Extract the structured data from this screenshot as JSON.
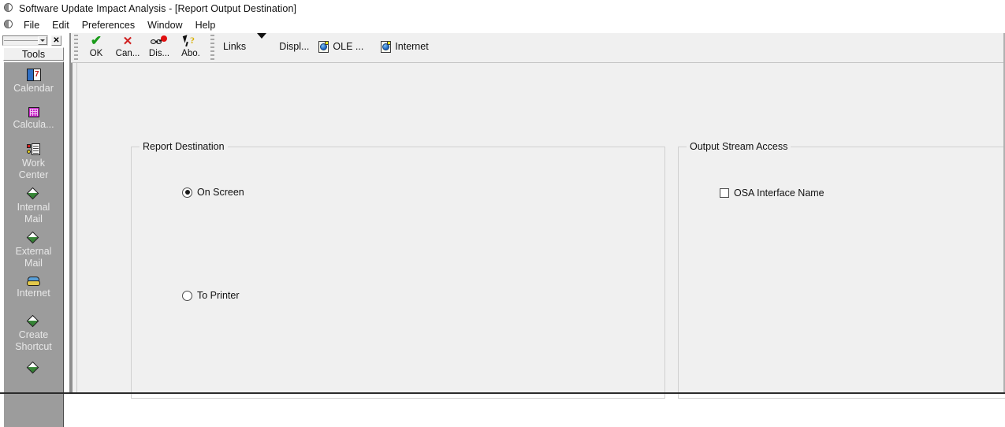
{
  "window": {
    "title": "Software Update Impact Analysis - [Report Output Destination]",
    "icon": "window-circle-icon"
  },
  "menubar": {
    "icon": "window-circle-icon",
    "items": [
      {
        "label": "File"
      },
      {
        "label": "Edit"
      },
      {
        "label": "Preferences"
      },
      {
        "label": "Window"
      },
      {
        "label": "Help"
      }
    ]
  },
  "sidebar": {
    "tab_label": "Tools",
    "dropdown_icon": "chevron-down-icon",
    "close_icon": "close-icon",
    "items": [
      {
        "label": "Calendar",
        "icon": "calendar-icon"
      },
      {
        "label": "Calcula...",
        "icon": "calculator-icon"
      },
      {
        "label": "Work\nCenter",
        "icon": "work-center-icon"
      },
      {
        "label": "Internal\nMail",
        "icon": "mail-diamond-icon"
      },
      {
        "label": "External\nMail",
        "icon": "mail-diamond-icon"
      },
      {
        "label": "Internet",
        "icon": "telephone-icon"
      },
      {
        "label": "Create\nShortcut",
        "icon": "shortcut-diamond-icon"
      }
    ]
  },
  "toolbar": {
    "buttons": [
      {
        "label": "OK",
        "icon": "check-icon"
      },
      {
        "label": "Can...",
        "icon": "cancel-x-icon"
      },
      {
        "label": "Dis...",
        "icon": "display-glasses-icon"
      },
      {
        "label": "Abo.",
        "icon": "about-help-cursor-icon"
      }
    ],
    "links_label": "Links",
    "links_arrow_icon": "chevron-down-icon",
    "display_label": "Displ...",
    "ole_label": "OLE ...",
    "ole_icon": "ole-document-icon",
    "internet_label": "Internet",
    "internet_icon": "internet-document-icon"
  },
  "main": {
    "report_destination": {
      "title": "Report Destination",
      "options": [
        {
          "label": "On Screen",
          "selected": true
        },
        {
          "label": "To Printer",
          "selected": false
        }
      ]
    },
    "output_stream_access": {
      "title": "Output Stream Access",
      "checkboxes": [
        {
          "label": "OSA Interface Name",
          "checked": false
        }
      ]
    }
  },
  "colors": {
    "window_background": "#f0f0f0",
    "sidebar_background": "#9c9c9c",
    "sidebar_text": "#e8e8e8",
    "accent_check": "#1a9b1a",
    "accent_cancel": "#d02020",
    "highlight": "#ffff00"
  }
}
